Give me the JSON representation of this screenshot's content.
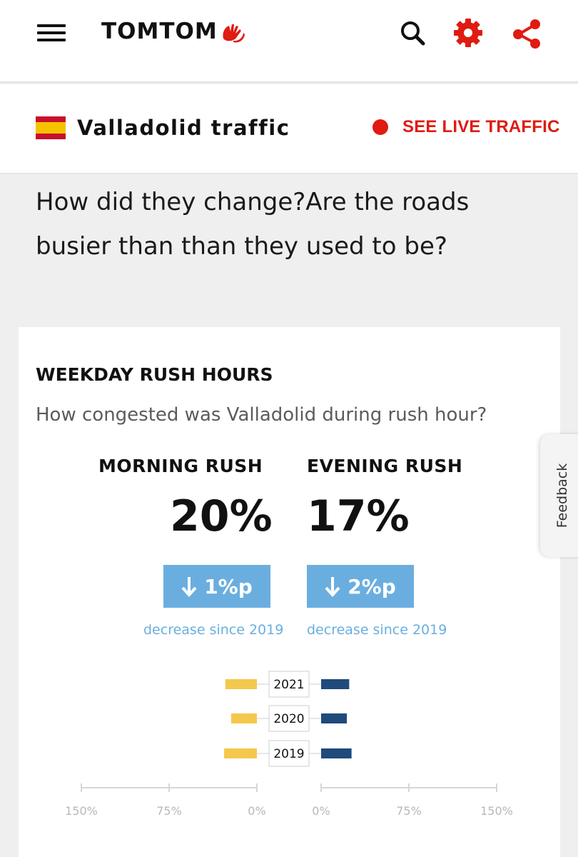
{
  "header": {
    "logo_text": "TOMTOM",
    "icons": {
      "menu": "hamburger-menu-icon",
      "search": "search-icon",
      "settings": "gear-icon",
      "share": "share-icon",
      "logo": "tomtom-hands-icon"
    },
    "accent_color": "#df1b12"
  },
  "city_bar": {
    "flag": "spain-flag",
    "title": "Valladolid traffic",
    "live_label": "SEE LIVE TRAFFIC"
  },
  "question": "How did they change?Are the roads busier than than they used to be?",
  "card": {
    "title": "WEEKDAY RUSH HOURS",
    "subtitle": "How congested was Valladolid during rush hour?",
    "morning": {
      "label": "MORNING RUSH",
      "value": "20%",
      "change": "1%p",
      "change_note": "decrease since 2019"
    },
    "evening": {
      "label": "EVENING RUSH",
      "value": "17%",
      "change": "2%p",
      "change_note": "decrease since 2019"
    },
    "change_color": "#6aaee0"
  },
  "chart_data": {
    "type": "bar",
    "categories": [
      "2021",
      "2020",
      "2019"
    ],
    "series": [
      {
        "color": "#f4c84d",
        "values": [
          27,
          22,
          28
        ]
      },
      {
        "color": "#1f4a7c",
        "values": [
          24,
          22,
          26
        ]
      }
    ],
    "left_ticks": [
      "150%",
      "75%",
      "0%"
    ],
    "right_ticks": [
      "0%",
      "75%",
      "150%"
    ],
    "xlim": [
      0,
      150
    ]
  },
  "feedback_label": "Feedback"
}
